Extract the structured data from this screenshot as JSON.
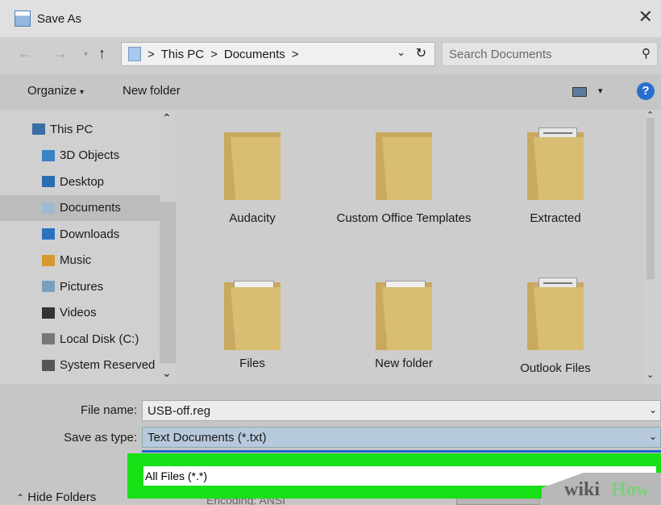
{
  "window": {
    "title": "Save As",
    "close_icon": "close-icon"
  },
  "address": {
    "crumbs": [
      "This PC",
      "Documents"
    ],
    "separator": ">",
    "search_placeholder": "Search Documents"
  },
  "toolbar": {
    "organize": "Organize",
    "organize_arrow": "▾",
    "new_folder": "New folder",
    "help": "?"
  },
  "nav": {
    "items": [
      {
        "label": "This PC",
        "icon": "pc-icon",
        "color": "#3a6ea5"
      },
      {
        "label": "3D Objects",
        "icon": "3d-objects-icon",
        "color": "#3a82c8"
      },
      {
        "label": "Desktop",
        "icon": "desktop-icon",
        "color": "#2a6cb0"
      },
      {
        "label": "Documents",
        "icon": "documents-icon",
        "color": "#a0b8d0",
        "selected": true
      },
      {
        "label": "Downloads",
        "icon": "downloads-icon",
        "color": "#2a72c0"
      },
      {
        "label": "Music",
        "icon": "music-icon",
        "color": "#d89a30"
      },
      {
        "label": "Pictures",
        "icon": "pictures-icon",
        "color": "#7aa0c0"
      },
      {
        "label": "Videos",
        "icon": "videos-icon",
        "color": "#333333"
      },
      {
        "label": "Local Disk (C:)",
        "icon": "drive-icon",
        "color": "#777777"
      },
      {
        "label": "System Reserved",
        "icon": "drive-icon",
        "color": "#555555"
      }
    ]
  },
  "files": [
    {
      "name": "Audacity",
      "kind": "folder"
    },
    {
      "name": "Custom Office Templates",
      "kind": "folder"
    },
    {
      "name": "Extracted",
      "kind": "folder-doc"
    },
    {
      "name": "Files",
      "kind": "folder-edge",
      "badge": "pdf"
    },
    {
      "name": "New folder",
      "kind": "folder-edge",
      "badge": "pdf"
    },
    {
      "name": "Outlook Files",
      "kind": "folder-doc"
    }
  ],
  "form": {
    "file_name_label": "File name:",
    "file_name_value": "USB-off.reg",
    "save_type_label": "Save as type:",
    "save_type_value": "Text Documents (*.txt)",
    "dropdown_option": "All Files  (*.*)",
    "hide_folders": "Hide Folders",
    "encoding_label": "Encoding:  ANSI"
  },
  "watermark": {
    "wiki": "wiki",
    "how": "How"
  },
  "colors": {
    "highlight": "#16e016",
    "selection": "#1e66d0",
    "help": "#2a6fd0"
  }
}
